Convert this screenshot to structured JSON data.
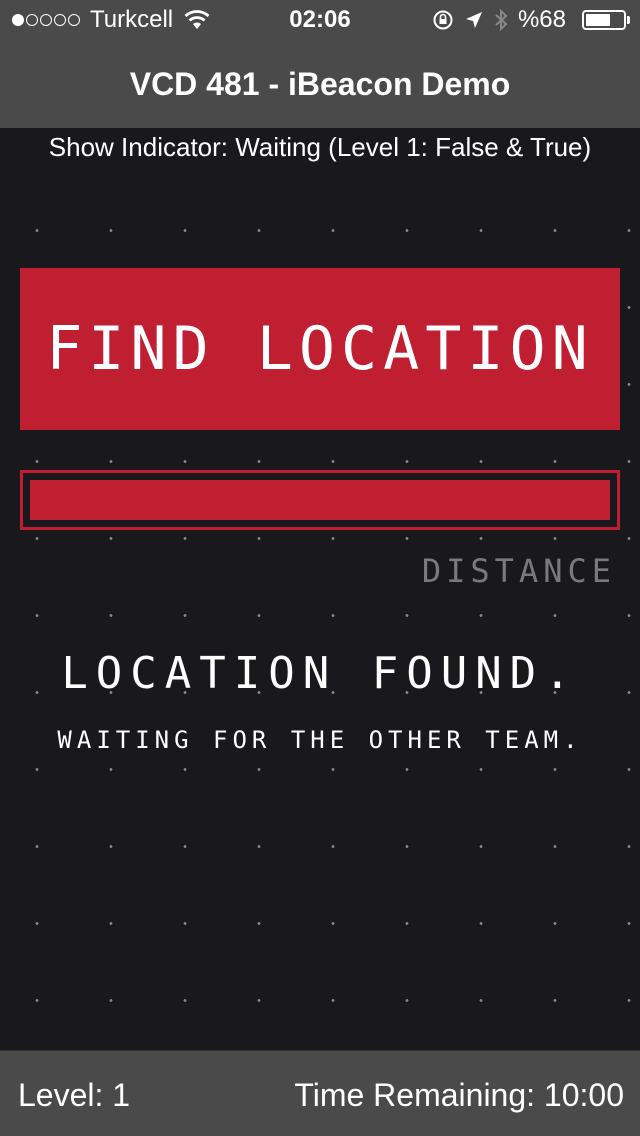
{
  "status_bar": {
    "carrier": "Turkcell",
    "time": "02:06",
    "battery": "%68",
    "battery_level": 0.68,
    "signal_strength": 1,
    "signal_max": 5
  },
  "nav": {
    "title": "VCD 481 - iBeacon Demo"
  },
  "main": {
    "indicator": "Show Indicator: Waiting (Level 1: False & True)",
    "find_button_label": "FIND LOCATION",
    "distance_label": "DISTANCE",
    "distance_fill": 1.0,
    "found_title": "LOCATION FOUND.",
    "waiting_text": "WAITING FOR THE OTHER TEAM."
  },
  "footer": {
    "level": "Level: 1",
    "time_remaining": "Time Remaining: 10:00"
  },
  "colors": {
    "accent_red": "#c01e31",
    "bar_gray": "#4a4a4a",
    "background": "#19181d"
  },
  "icons": [
    "wifi-icon",
    "rotation-lock-icon",
    "location-arrow-icon",
    "bluetooth-icon",
    "battery-icon"
  ]
}
